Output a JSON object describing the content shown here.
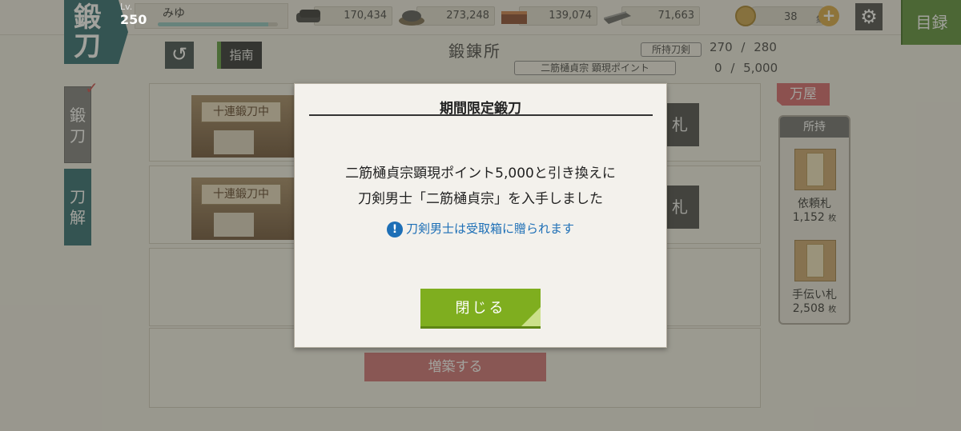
{
  "header": {
    "section_title": [
      "鍛",
      "刀"
    ],
    "level_label": "Lv.",
    "level": "250",
    "user_name": "みゆ",
    "exp_progress": 0.92,
    "resources": [
      {
        "name": "charcoal",
        "icon": "charcoal-icon",
        "value": "170,434"
      },
      {
        "name": "tamahagane",
        "icon": "tamahagane-icon",
        "value": "273,248"
      },
      {
        "name": "cooling-material",
        "icon": "cooling-material-icon",
        "value": "139,074"
      },
      {
        "name": "whetstone",
        "icon": "whetstone-icon",
        "value": "71,663"
      }
    ],
    "coins": {
      "value": "38",
      "unit": "集",
      "plus": "+"
    },
    "settings_icon": "⚙",
    "catalog_label": "目録"
  },
  "subheader": {
    "back_icon": "↺",
    "guide_label": "指南",
    "page_title": "鍛錬所",
    "owned_swords_label": "所持刀剣",
    "owned_swords_current": "270",
    "owned_swords_sep": "/",
    "owned_swords_max": "280",
    "points_label": "二筋樋貞宗 顕現ポイント",
    "points_current": "0",
    "points_sep": "/",
    "points_max": "5,000"
  },
  "side_tabs": [
    {
      "label": "鍛刀",
      "active": true
    },
    {
      "label": "刀解",
      "active": false
    }
  ],
  "slots": [
    {
      "status": "十連鍛刀中",
      "action": "札"
    },
    {
      "status": "十連鍛刀中",
      "action": "札"
    }
  ],
  "expand_label": "増築する",
  "shop": {
    "tab_label": "万屋",
    "owned_title": "所持",
    "items": [
      {
        "name": "依頼札",
        "count": "1,152",
        "unit": "枚",
        "glyph": "依頼札"
      },
      {
        "name": "手伝い札",
        "count": "2,508",
        "unit": "枚",
        "glyph": "手伝い札"
      }
    ]
  },
  "modal": {
    "title": "期間限定鍛刀",
    "message_line1": "二筋樋貞宗顕現ポイント5,000と引き換えに",
    "message_line2": "刀剣男士「二筋樋貞宗」を入手しました",
    "note_icon": "!",
    "note": "刀剣男士は受取箱に贈られます",
    "close_label": "閉じる"
  },
  "colors": {
    "accent_teal": "#2d6a6f",
    "button_green": "#7fae1f",
    "note_blue": "#1d6fb6",
    "shop_pink": "#d5646a"
  }
}
